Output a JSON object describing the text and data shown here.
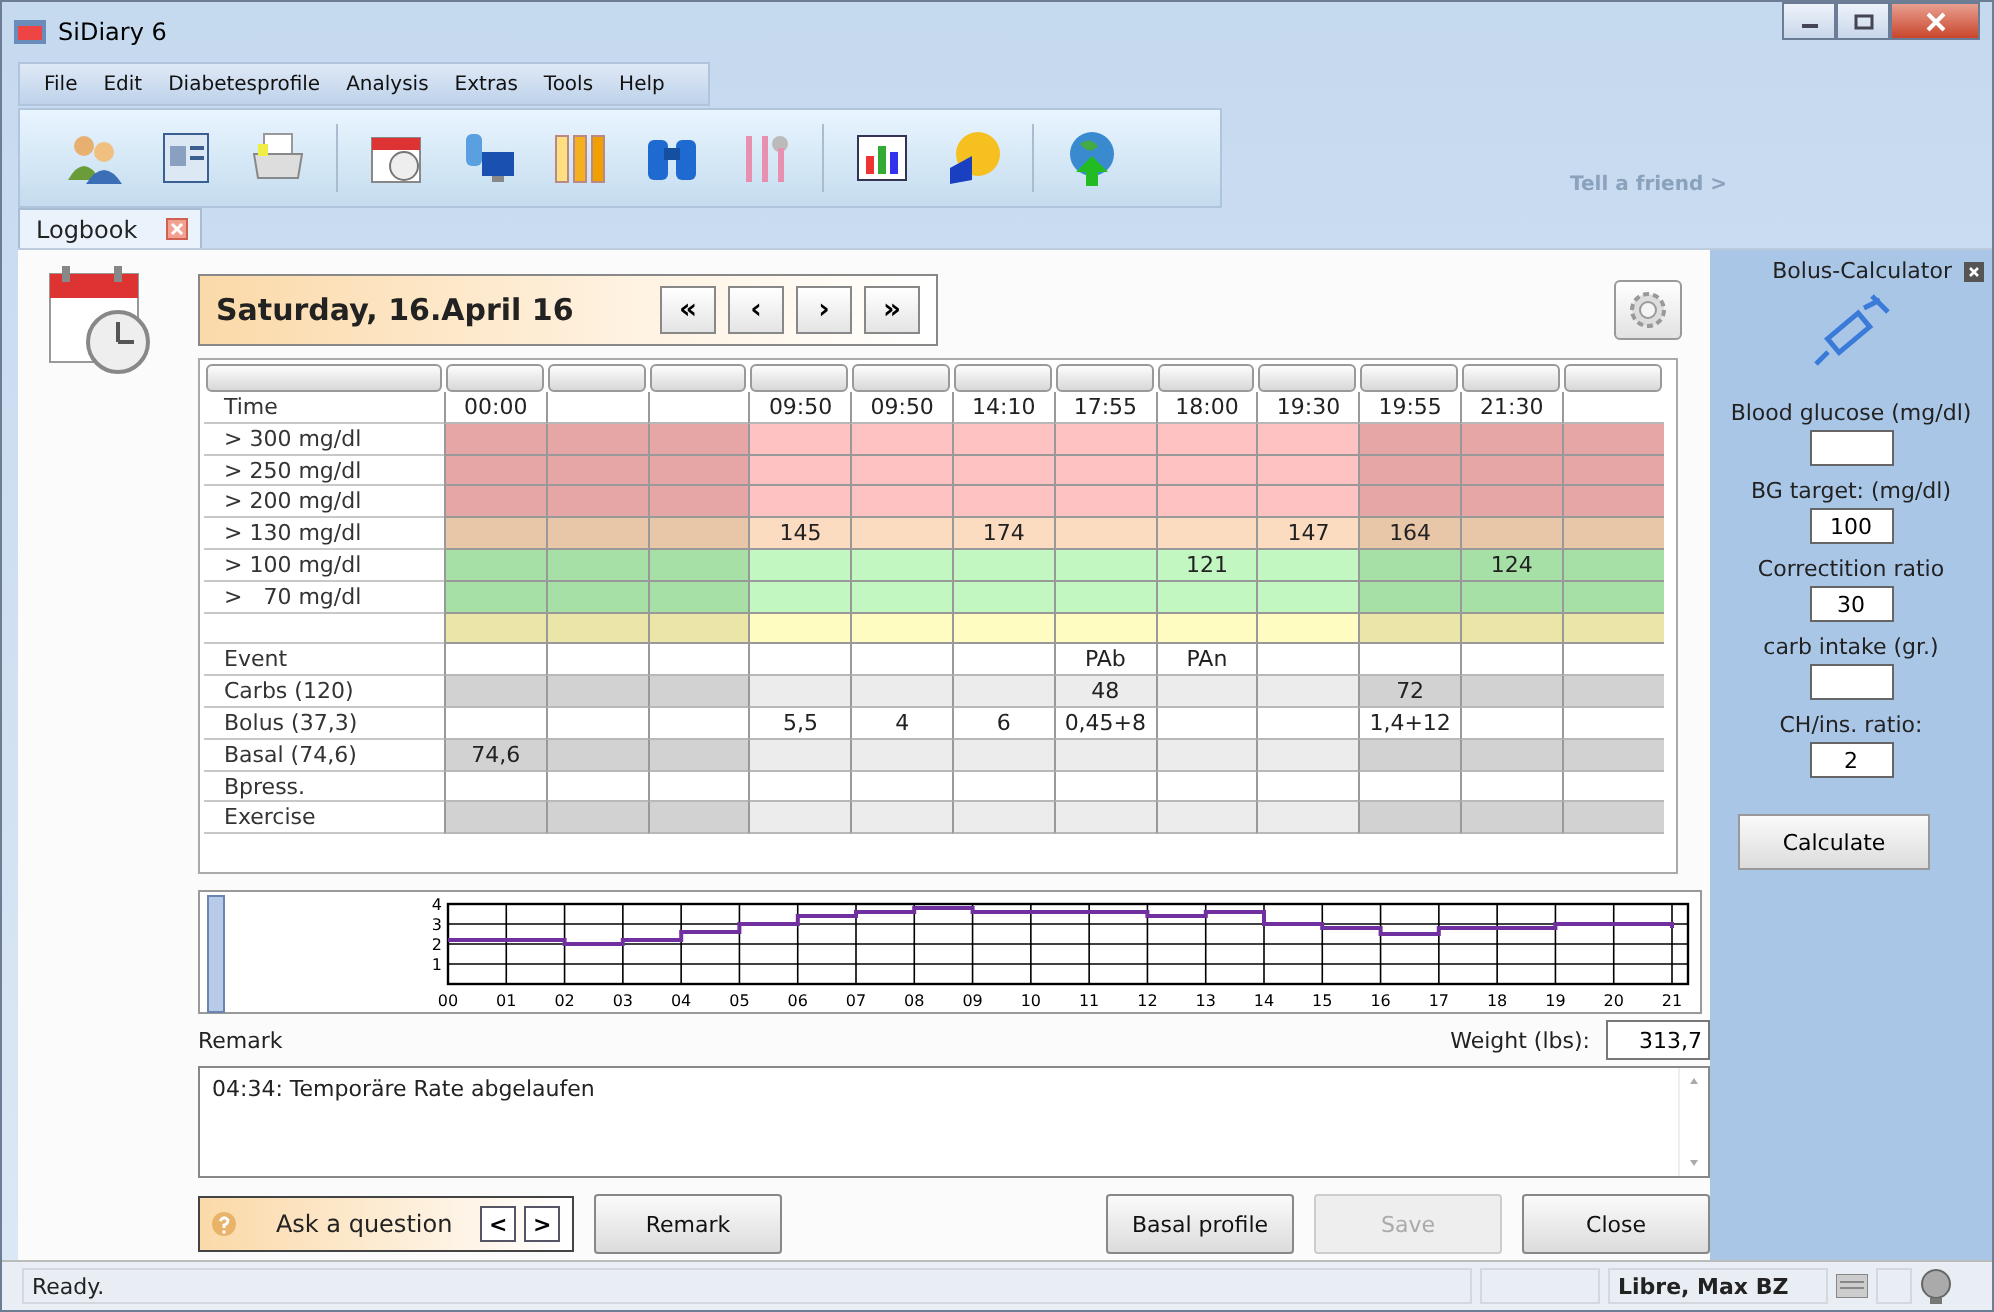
{
  "window": {
    "title": "SiDiary 6"
  },
  "menu": [
    "File",
    "Edit",
    "Diabetesprofile",
    "Analysis",
    "Extras",
    "Tools",
    "Help"
  ],
  "toolbar_link": "Tell a friend >",
  "tabs": [
    {
      "label": "Logbook",
      "selected": true
    }
  ],
  "date_header": {
    "date": "Saturday, 16.April 16",
    "nav": [
      "«",
      "‹",
      "›",
      "»"
    ]
  },
  "table": {
    "columns": [
      {
        "time": "00:00",
        "shaded": true
      },
      {
        "shaded": true
      },
      {
        "shaded": true
      },
      {
        "time": "09:50",
        "shaded": false
      },
      {
        "time": "09:50",
        "shaded": false
      },
      {
        "time": "14:10",
        "shaded": false
      },
      {
        "time": "17:55",
        "shaded": false
      },
      {
        "time": "18:00",
        "shaded": false
      },
      {
        "time": "19:30",
        "shaded": false
      },
      {
        "time": "19:55",
        "shaded": true
      },
      {
        "time": "21:30",
        "shaded": true
      },
      {
        "shaded": true
      }
    ],
    "time_label": "Time",
    "rows": [
      {
        "label": "> 300 mg/dl",
        "kind": "high",
        "values": {}
      },
      {
        "label": "> 250 mg/dl",
        "kind": "high",
        "values": {}
      },
      {
        "label": "> 200 mg/dl",
        "kind": "high",
        "values": {}
      },
      {
        "label": "> 130 mg/dl",
        "kind": "elevated",
        "values": {
          "3": "145",
          "5": "174",
          "8": "147",
          "9": "164"
        }
      },
      {
        "label": "> 100 mg/dl",
        "kind": "target",
        "values": {
          "7": "121",
          "10": "124"
        }
      },
      {
        "label": ">   70 mg/dl",
        "kind": "target",
        "values": {}
      },
      {
        "kind": "low",
        "values": {}
      },
      {
        "label": "Event",
        "kind": "plain",
        "values": {
          "6": "PAb",
          "7": "PAn"
        }
      },
      {
        "label": "Carbs (120)",
        "kind": "gray",
        "values": {
          "6": "48",
          "9": "72"
        }
      },
      {
        "label": "Bolus (37,3)",
        "kind": "plain",
        "values": {
          "3": "5,5",
          "4": "4",
          "5": "6",
          "6": "0,45+8",
          "9": "1,4+12"
        }
      },
      {
        "label": "Basal (74,6)",
        "kind": "gray",
        "values": {
          "0": "74,6"
        }
      },
      {
        "label": "Bpress.",
        "kind": "plain",
        "values": {}
      },
      {
        "label": "Exercise",
        "kind": "gray",
        "values": {}
      }
    ]
  },
  "chart_data": {
    "type": "line",
    "grid": true,
    "xlim": [
      0,
      21
    ],
    "ylim": [
      0,
      4
    ],
    "yticks": [
      1,
      2,
      3,
      4
    ],
    "xticks": [
      {
        "value": 0,
        "label": "00"
      },
      {
        "value": 1,
        "label": "01"
      },
      {
        "value": 2,
        "label": "02"
      },
      {
        "value": 3,
        "label": "03"
      },
      {
        "value": 4,
        "label": "04"
      },
      {
        "value": 5,
        "label": "05"
      },
      {
        "value": 6,
        "label": "06"
      },
      {
        "value": 7,
        "label": "07"
      },
      {
        "value": 8,
        "label": "08"
      },
      {
        "value": 9,
        "label": "09"
      },
      {
        "value": 10,
        "label": "10"
      },
      {
        "value": 11,
        "label": "11"
      },
      {
        "value": 12,
        "label": "12"
      },
      {
        "value": 13,
        "label": "13"
      },
      {
        "value": 14,
        "label": "14"
      },
      {
        "value": 15,
        "label": "15"
      },
      {
        "value": 16,
        "label": "16"
      },
      {
        "value": 17,
        "label": "17"
      },
      {
        "value": 18,
        "label": "18"
      },
      {
        "value": 19,
        "label": "19"
      },
      {
        "value": 20,
        "label": "20"
      },
      {
        "value": 21,
        "label": "21"
      }
    ],
    "x": [
      0,
      1,
      1,
      2,
      2,
      3,
      3,
      4,
      4,
      5,
      5,
      6,
      6,
      7,
      7,
      8,
      8,
      9,
      9,
      10,
      10,
      11,
      11,
      12,
      12,
      13,
      13,
      14,
      14,
      15,
      15,
      16,
      16,
      17,
      17,
      18,
      18,
      19,
      19,
      20,
      20,
      21,
      21
    ],
    "series": [
      {
        "color": "#7030a0",
        "values": [
          2.2,
          2.2,
          2.2,
          2.2,
          2.0,
          2.0,
          2.2,
          2.2,
          2.6,
          2.6,
          3.0,
          3.0,
          3.4,
          3.4,
          3.6,
          3.6,
          3.8,
          3.8,
          3.6,
          3.6,
          3.6,
          3.6,
          3.6,
          3.6,
          3.4,
          3.4,
          3.6,
          3.6,
          3.0,
          3.0,
          2.8,
          2.8,
          2.5,
          2.5,
          2.8,
          2.8,
          2.8,
          2.8,
          3.0,
          3.0,
          3.0,
          3.0,
          2.8
        ]
      }
    ]
  },
  "remark": {
    "label": "Remark",
    "weight_label": "Weight (lbs):",
    "weight": "313,7",
    "text": "04:34: Temporäre Rate abgelaufen"
  },
  "ask": {
    "label": "Ask a question",
    "prev": "<",
    "next": ">"
  },
  "buttons": [
    {
      "label": "Remark",
      "disabled": false
    },
    {
      "label": "Basal profile",
      "disabled": false
    },
    {
      "label": "Save",
      "disabled": true
    },
    {
      "label": "Close",
      "disabled": false
    }
  ],
  "bolus_calculator": {
    "title": "Bolus-Calculator",
    "fields": [
      {
        "label": "Blood glucose (mg/dl)"
      },
      {
        "label": "BG target: (mg/dl)",
        "value": "100"
      },
      {
        "label": "Correctition ratio",
        "value": "30"
      },
      {
        "label": "carb intake (gr.)"
      },
      {
        "label": "CH/ins. ratio:",
        "value": "2"
      }
    ],
    "button": "Calculate"
  },
  "status_bar": {
    "message": "Ready.",
    "user": "Libre, Max BZ"
  }
}
